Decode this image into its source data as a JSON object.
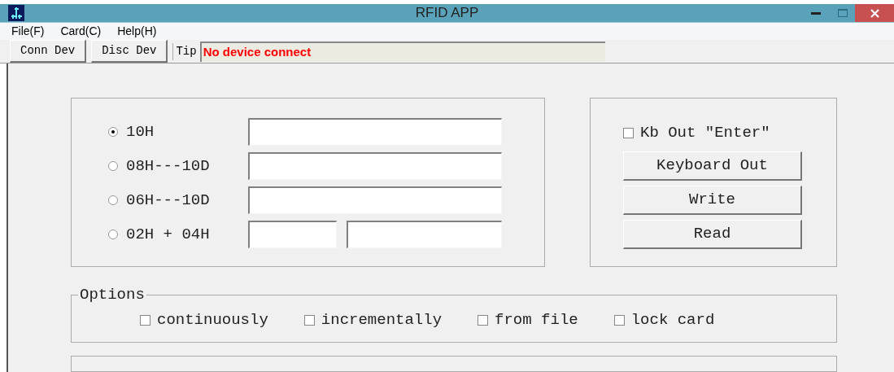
{
  "window": {
    "title": "RFID APP"
  },
  "menu": [
    "File(F)",
    "Card(C)",
    "Help(H)"
  ],
  "toolbar": {
    "buttons": [
      "Conn Dev",
      "Disc Dev"
    ],
    "tip_label": "Tip",
    "tip": "No device connect"
  },
  "formats": [
    {
      "label": "10H",
      "selected": true,
      "kind": "single"
    },
    {
      "label": "08H---10D",
      "selected": false,
      "kind": "single"
    },
    {
      "label": "06H---10D",
      "selected": false,
      "kind": "single"
    },
    {
      "label": "02H + 04H",
      "selected": false,
      "kind": "split"
    }
  ],
  "output": {
    "kb_enter": {
      "label": "Kb Out \"Enter\"",
      "checked": false
    },
    "buttons": [
      "Keyboard Out",
      "Write",
      "Read"
    ]
  },
  "options": {
    "title": "Options",
    "items": [
      {
        "label": "continuously",
        "checked": false
      },
      {
        "label": "incrementally",
        "checked": false
      },
      {
        "label": "from file",
        "checked": false
      },
      {
        "label": "lock card",
        "checked": false
      }
    ]
  }
}
